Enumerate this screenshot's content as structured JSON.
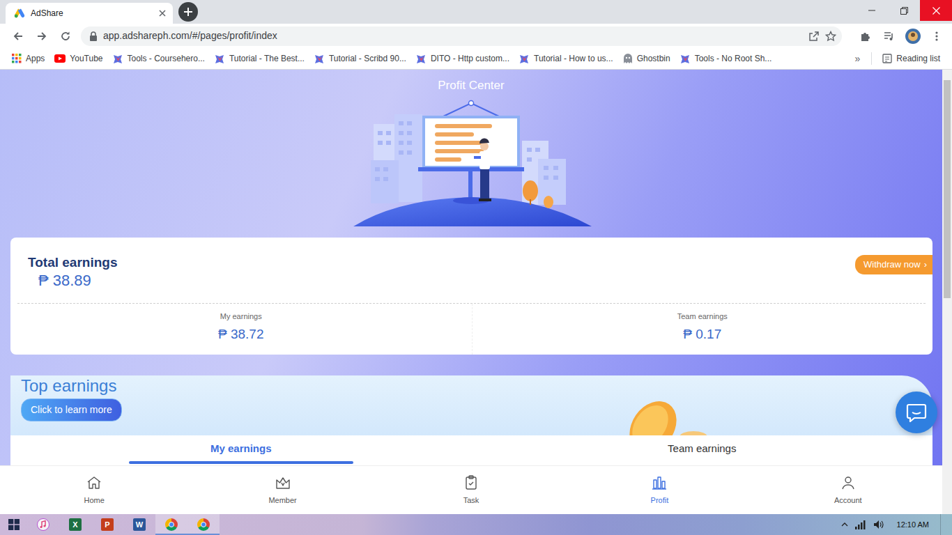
{
  "browser": {
    "tabs": [
      {
        "title": "AdShare",
        "selected": true
      }
    ],
    "address": "app.adshareph.com/#/pages/profit/index",
    "bookmarks": [
      {
        "label": "Apps",
        "kind": "apps"
      },
      {
        "label": "YouTube",
        "kind": "youtube"
      },
      {
        "label": "Tools - Coursehero...",
        "kind": "tool"
      },
      {
        "label": "Tutorial - The Best...",
        "kind": "tool"
      },
      {
        "label": "Tutorial - Scribd 90...",
        "kind": "tool"
      },
      {
        "label": "DITO - Http custom...",
        "kind": "tool"
      },
      {
        "label": "Tutorial - How to us...",
        "kind": "tool"
      },
      {
        "label": "Ghostbin",
        "kind": "ghost"
      },
      {
        "label": "Tools - No Root Sh...",
        "kind": "tool"
      }
    ],
    "bookmarks_more": "»",
    "reading_list": "Reading list"
  },
  "page": {
    "title": "Profit Center",
    "total": {
      "label": "Total earnings",
      "amount": "₱ 38.89"
    },
    "withdraw": {
      "label": "Withdraw now",
      "chevron": "›"
    },
    "breakdown": [
      {
        "label": "My earnings",
        "amount": "₱ 38.72"
      },
      {
        "label": "Team earnings",
        "amount": "₱ 0.17"
      }
    ],
    "promo": {
      "title": "Top earnings",
      "button": "Click to learn more"
    },
    "tabs": [
      {
        "label": "My earnings",
        "selected": true
      },
      {
        "label": "Team earnings",
        "selected": false
      }
    ],
    "nav": [
      {
        "label": "Home",
        "kind": "home",
        "selected": false
      },
      {
        "label": "Member",
        "kind": "member",
        "selected": false
      },
      {
        "label": "Task",
        "kind": "task",
        "selected": false
      },
      {
        "label": "Profit",
        "kind": "profit",
        "selected": true
      },
      {
        "label": "Account",
        "kind": "account",
        "selected": false
      }
    ],
    "scrollbar": {
      "level": 0.49
    }
  },
  "taskbar": {
    "apps": [
      {
        "kind": "itunes",
        "open": false
      },
      {
        "kind": "office",
        "letter": "X",
        "color": "#1d6f42",
        "open": false
      },
      {
        "kind": "office",
        "letter": "P",
        "color": "#c43e1c",
        "open": false
      },
      {
        "kind": "office",
        "letter": "W",
        "color": "#2b579a",
        "open": false
      },
      {
        "kind": "chrome",
        "open": true
      },
      {
        "kind": "chrome",
        "open": true
      }
    ],
    "clock": "12:10 AM"
  }
}
